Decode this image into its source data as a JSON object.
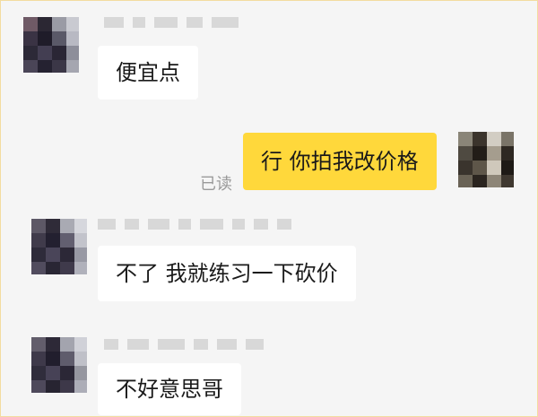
{
  "messages": [
    {
      "side": "left",
      "text": "便宜点"
    },
    {
      "side": "right",
      "text": "行 你拍我改价格",
      "status": "已读"
    },
    {
      "side": "left",
      "text": "不了 我就练习一下砍价"
    },
    {
      "side": "left",
      "text": "不好意思哥"
    }
  ],
  "colors": {
    "page_background": "#f5f5f5",
    "incoming_bubble": "#ffffff",
    "outgoing_bubble": "#ffd83b",
    "read_receipt_text": "#9a9a9a"
  }
}
